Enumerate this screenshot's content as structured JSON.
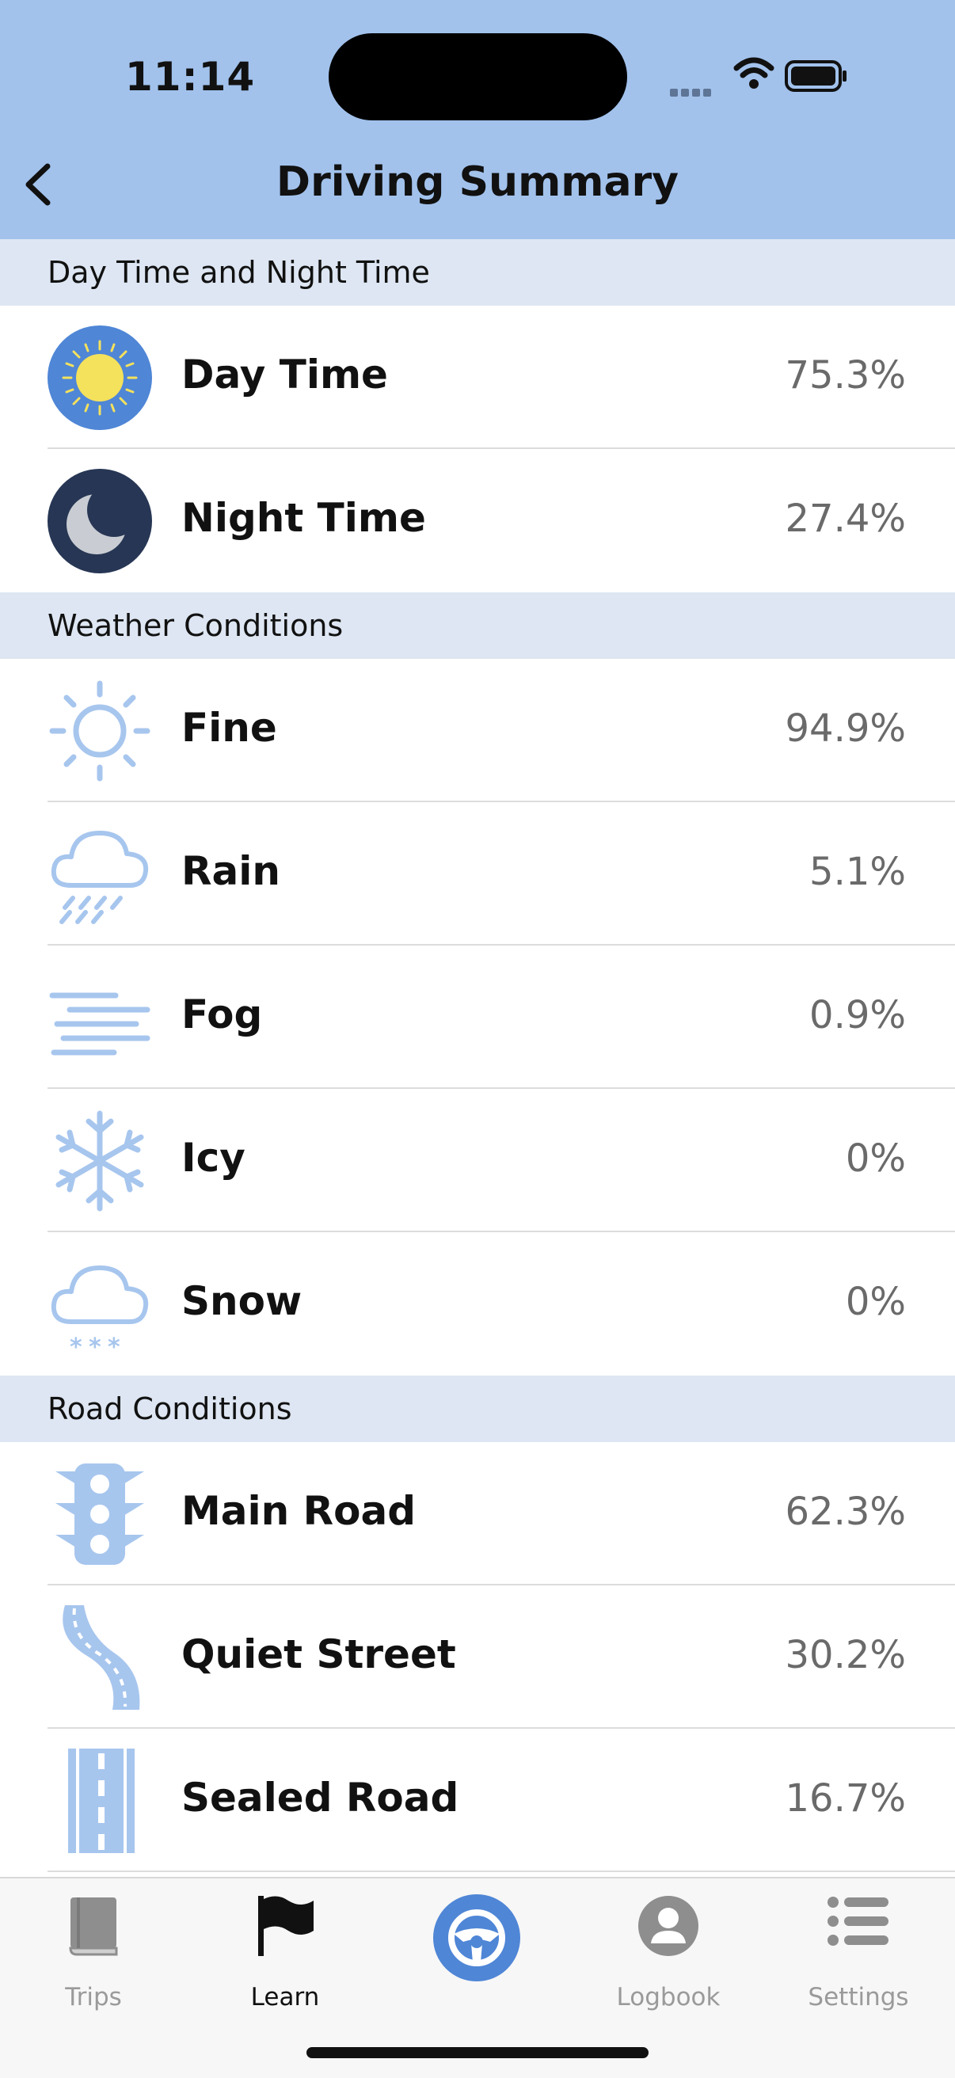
{
  "status_bar": {
    "time": "11:14"
  },
  "header": {
    "title": "Driving Summary"
  },
  "sections": [
    {
      "title": "Day Time and Night Time"
    },
    {
      "title": "Weather Conditions"
    },
    {
      "title": "Road Conditions"
    }
  ],
  "rows": [
    {
      "label": "Day Time",
      "value": "75.3%",
      "icon": "sun-badge-icon"
    },
    {
      "label": "Night Time",
      "value": "27.4%",
      "icon": "moon-badge-icon"
    },
    {
      "label": "Fine",
      "value": "94.9%",
      "icon": "sun-icon"
    },
    {
      "label": "Rain",
      "value": "5.1%",
      "icon": "rain-cloud-icon"
    },
    {
      "label": "Fog",
      "value": "0.9%",
      "icon": "fog-icon"
    },
    {
      "label": "Icy",
      "value": "0%",
      "icon": "snowflake-icon"
    },
    {
      "label": "Snow",
      "value": "0%",
      "icon": "snow-cloud-icon"
    },
    {
      "label": "Main Road",
      "value": "62.3%",
      "icon": "traffic-light-icon"
    },
    {
      "label": "Quiet Street",
      "value": "30.2%",
      "icon": "winding-road-icon"
    },
    {
      "label": "Sealed Road",
      "value": "16.7%",
      "icon": "straight-road-icon"
    }
  ],
  "tabs": [
    {
      "label": "Trips",
      "icon": "book-icon"
    },
    {
      "label": "Learn",
      "icon": "flag-icon",
      "active": true
    },
    {
      "label": "",
      "icon": "steering-wheel-icon"
    },
    {
      "label": "Logbook",
      "icon": "person-icon"
    },
    {
      "label": "Settings",
      "icon": "list-icon"
    }
  ],
  "colors": {
    "header_bg": "#a2c2ec",
    "section_bg": "#dde6f2",
    "icon_blue": "#a7c6ee",
    "accent": "#4f86d6"
  }
}
